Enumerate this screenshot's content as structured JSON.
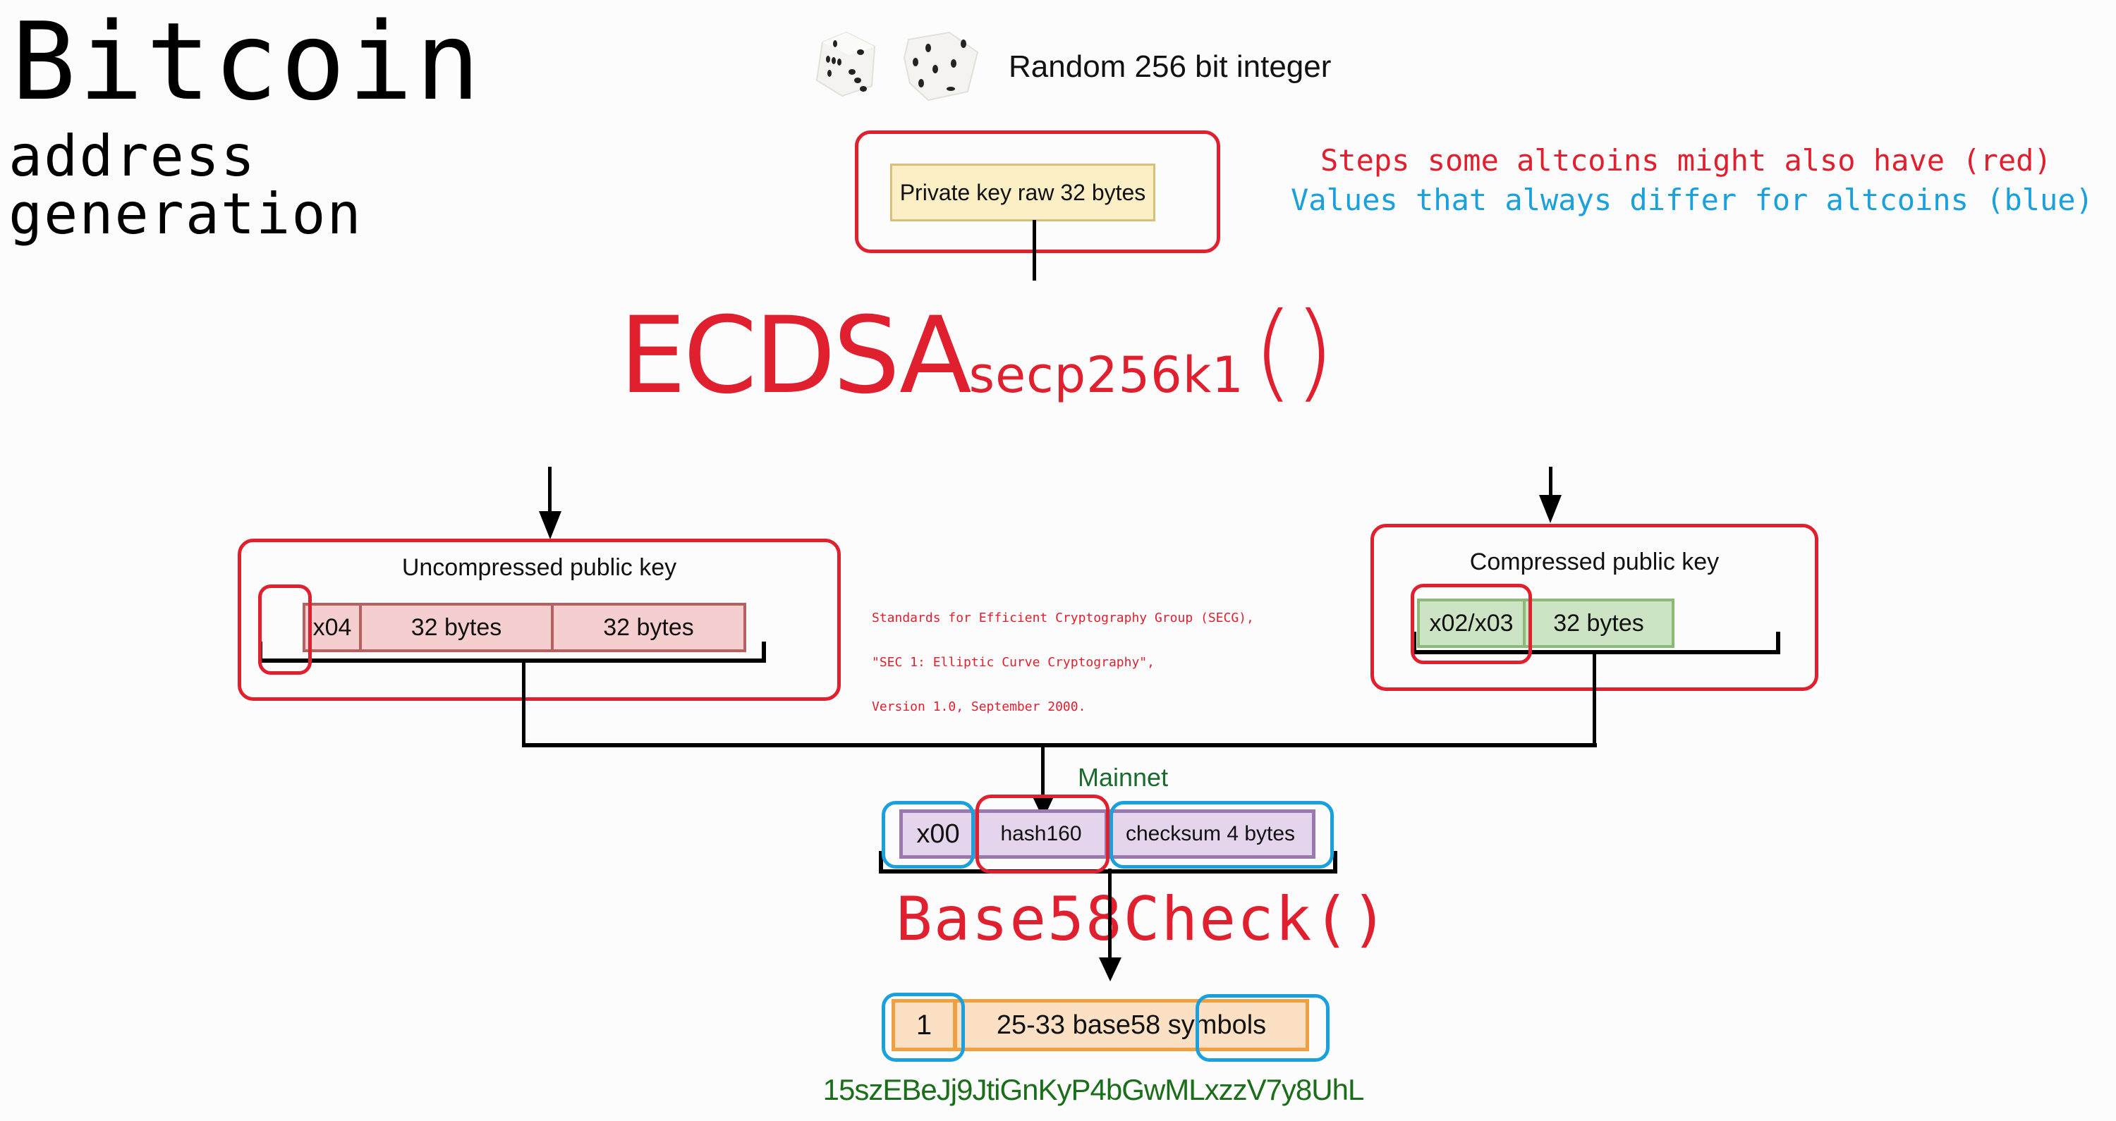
{
  "title": {
    "main": "Bitcoin",
    "line2": "address",
    "line3": "generation"
  },
  "legend": {
    "red": "Steps some altcoins might also have (red)",
    "blue": "Values that always differ for altcoins (blue)",
    "red_color": "#e0202e",
    "blue_color": "#1aa0dc"
  },
  "random": {
    "icon": "dice-icon",
    "label": "Random 256 bit integer"
  },
  "private_key": {
    "label": "Private key raw 32 bytes"
  },
  "ecdsa": {
    "name": "ECDSA",
    "curve": "secp256k1",
    "parens": "()"
  },
  "citation": {
    "lines": [
      "Standards for Efficient Cryptography Group (SECG),",
      "\"SEC 1: Elliptic Curve Cryptography\",",
      "Version 1.0, September 2000."
    ]
  },
  "uncompressed": {
    "title": "Uncompressed public key",
    "cells": [
      "x04",
      "32 bytes",
      "32 bytes"
    ]
  },
  "compressed": {
    "title": "Compressed public key",
    "cells": [
      "x02/x03",
      "32 bytes"
    ]
  },
  "payload": {
    "network_label": "Mainnet",
    "cells": [
      "x00",
      "hash160",
      "checksum 4 bytes"
    ]
  },
  "base58": {
    "label": "Base58Check()"
  },
  "address": {
    "cells": [
      "1",
      "25-33 base58 symbols"
    ],
    "example": "15szEBeJj9JtiGnKyP4bGwMLxzzV7y8UhL"
  }
}
